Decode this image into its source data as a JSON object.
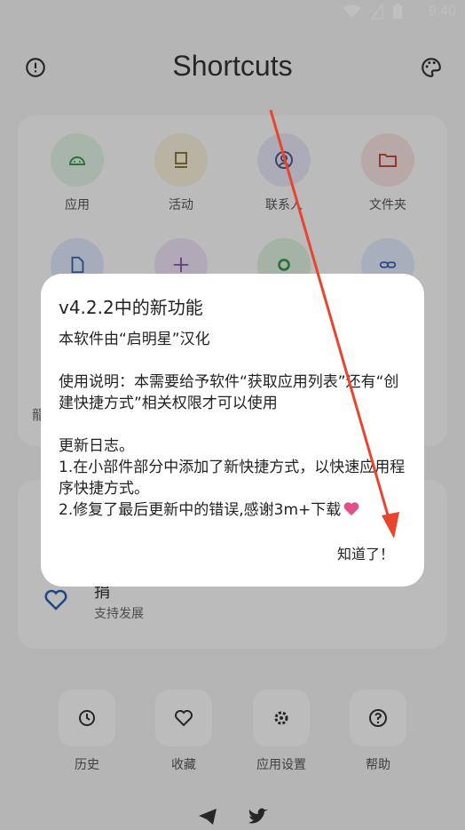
{
  "status": {
    "time": "9:40"
  },
  "app": {
    "title": "Shortcuts"
  },
  "grid": [
    {
      "label": "应用",
      "color": "#dff2e3",
      "icon": "android-icon",
      "icon_color": "#3a9a4f"
    },
    {
      "label": "活动",
      "color": "#f6efd8",
      "icon": "activity-icon",
      "icon_color": "#8b7a3a"
    },
    {
      "label": "联系人",
      "color": "#e5e6f5",
      "icon": "contact-icon",
      "icon_color": "#555a8a"
    },
    {
      "label": "文件夹",
      "color": "#f7e1e1",
      "icon": "folder-icon",
      "icon_color": "#c44a3a"
    }
  ],
  "grid_row2_colors": [
    "#dde6fb",
    "#ece2f4",
    "#dcefdf",
    "#dfe8fb"
  ],
  "donate": {
    "title": "捐",
    "subtitle": "支持发展"
  },
  "partial_text": "龍",
  "bottom": [
    {
      "label": "历史",
      "icon": "history-icon"
    },
    {
      "label": "收藏",
      "icon": "heart-icon"
    },
    {
      "label": "应用设置",
      "icon": "gear-icon"
    },
    {
      "label": "帮助",
      "icon": "help-icon"
    }
  ],
  "dialog": {
    "title": "v4.2.2中的新功能",
    "body": "本软件由“启明星”汉化\n\n使用说明：本需要给予软件“获取应用列表”还有“创建快捷方式”相关权限才可以使用\n\n更新日志。\n1.在小部件部分中添加了新快捷方式，以快速应用程序快捷方式。\n2.修复了最后更新中的错误,感谢3m+下载",
    "ok": "知道了！"
  },
  "colors": {
    "accent_arrow": "#e8452c",
    "heart": "#e0508a"
  }
}
